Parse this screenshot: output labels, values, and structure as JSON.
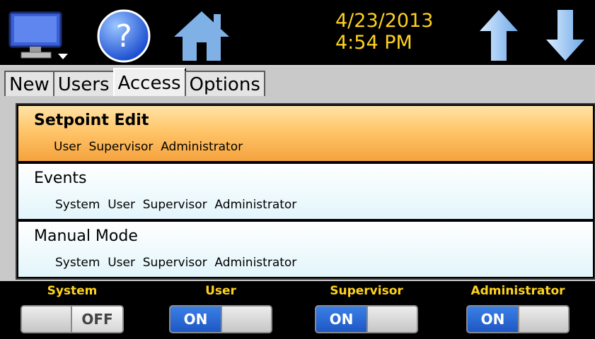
{
  "header": {
    "date": "4/23/2013",
    "time": "4:54 PM",
    "icons": [
      "monitor-icon",
      "help-icon",
      "home-icon",
      "up-arrow-icon",
      "down-arrow-icon"
    ]
  },
  "tabs": [
    {
      "label": "New"
    },
    {
      "label": "Users"
    },
    {
      "label": "Access",
      "active": true
    },
    {
      "label": "Options"
    }
  ],
  "access_list": [
    {
      "title": "Setpoint Edit",
      "roles": "User  Supervisor  Administrator",
      "selected": true
    },
    {
      "title": "Events",
      "roles": "System  User  Supervisor  Administrator"
    },
    {
      "title": "Manual Mode",
      "roles": "System  User  Supervisor  Administrator"
    }
  ],
  "toggles": [
    {
      "label": "System",
      "state": "OFF"
    },
    {
      "label": "User",
      "state": "ON"
    },
    {
      "label": "Supervisor",
      "state": "ON"
    },
    {
      "label": "Administrator",
      "state": "ON"
    }
  ],
  "colors": {
    "header_text": "#ffd21f",
    "selected_row": "#f5a33d",
    "toggle_on": "#1e57c4"
  }
}
